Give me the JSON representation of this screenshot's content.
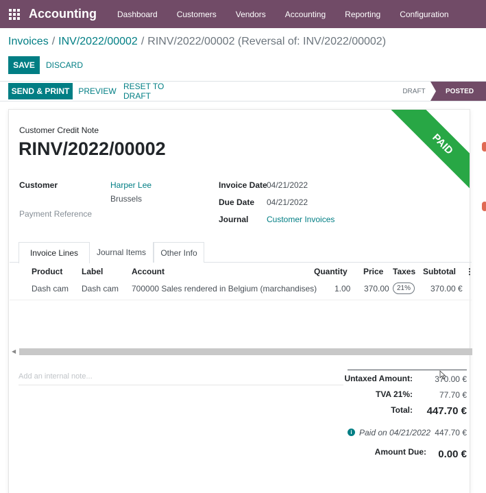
{
  "navbar": {
    "brand": "Accounting",
    "items": [
      "Dashboard",
      "Customers",
      "Vendors",
      "Accounting",
      "Reporting",
      "Configuration"
    ]
  },
  "breadcrumb": {
    "items": [
      "Invoices",
      "INV/2022/00002"
    ],
    "current": "RINV/2022/00002 (Reversal of: INV/2022/00002)"
  },
  "actions": {
    "save": "SAVE",
    "discard": "DISCARD"
  },
  "statusbar": {
    "send_print": "SEND & PRINT",
    "preview": "PREVIEW",
    "reset_to_draft": "RESET TO DRAFT",
    "stages": [
      "DRAFT",
      "POSTED"
    ]
  },
  "document": {
    "type": "Customer Credit Note",
    "number": "RINV/2022/00002",
    "ribbon": "PAID",
    "customer_label": "Customer",
    "customer_name": "Harper Lee",
    "customer_city": "Brussels",
    "payment_reference_label": "Payment Reference",
    "invoice_date_label": "Invoice Date",
    "invoice_date": "04/21/2022",
    "due_date_label": "Due Date",
    "due_date": "04/21/2022",
    "journal_label": "Journal",
    "journal": "Customer Invoices"
  },
  "tabs": [
    "Invoice Lines",
    "Journal Items",
    "Other Info"
  ],
  "lines": {
    "headers": [
      "Product",
      "Label",
      "Account",
      "Quantity",
      "Price",
      "Taxes",
      "Subtotal"
    ],
    "rows": [
      {
        "product": "Dash cam",
        "label": "Dash cam",
        "account": "700000 Sales rendered in Belgium (marchandises)",
        "quantity": "1.00",
        "price": "370.00",
        "taxes": "21%",
        "subtotal": "370.00 €"
      }
    ]
  },
  "note_placeholder": "Add an internal note...",
  "totals": {
    "untaxed_label": "Untaxed Amount:",
    "untaxed": "370.00 €",
    "tva_label": "TVA 21%:",
    "tva": "77.70 €",
    "total_label": "Total:",
    "total": "447.70 €",
    "paid_on": "Paid on 04/21/2022",
    "paid_amount": "447.70 €",
    "amount_due_label": "Amount Due:",
    "amount_due": "0.00 €"
  },
  "colors": {
    "brand": "#714b67",
    "accent": "#017e84",
    "paid": "#28a745"
  }
}
